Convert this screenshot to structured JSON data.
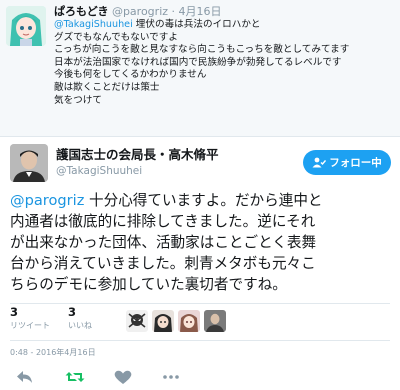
{
  "reply_tweet": {
    "name": "ぱろもどき",
    "handle": "@parogriz",
    "separator": "·",
    "date": "4月16日",
    "mention": "@TakagiShuuhei",
    "first_line_rest": " 埋伏の毒は兵法のイロハかと",
    "lines": [
      "グズでもなんでもないですよ",
      "こっちが向こうを敵と見なすなら向こうもこっちを敵としてみてます",
      "日本が法治国家でなければ国内で民族紛争が勃発してるレベルです",
      "今後も何をしてくるかわかりません",
      "敵は欺くことだけは策士",
      "気をつけて"
    ]
  },
  "main_tweet": {
    "name": "護国志士の会局長・高木脩平",
    "handle": "@TakagiShuuhei",
    "follow_label": "フォロー中",
    "mention": "@parogriz",
    "first_line_rest": " 十分心得ていますよ。だから連中と",
    "lines": [
      "内通者は徹底的に排除してきました。逆にそれ",
      "が出来なかった団体、活動家はことごとく表舞",
      "台から消えていきました。刺青メタボも元々こ",
      "ちらのデモに参加していた裏切者ですね。"
    ],
    "retweets": {
      "count": "3",
      "label": "リツイート"
    },
    "likes": {
      "count": "3",
      "label": "いいね"
    },
    "timestamp": "0:48 - 2016年4月16日"
  },
  "colors": {
    "accent": "#1da1f2",
    "link": "#1b95e0",
    "muted": "#8899a6",
    "retweet_green": "#17bf63"
  },
  "icons": [
    "reply-icon",
    "retweet-icon",
    "like-icon",
    "more-icon",
    "follow-person-icon"
  ]
}
